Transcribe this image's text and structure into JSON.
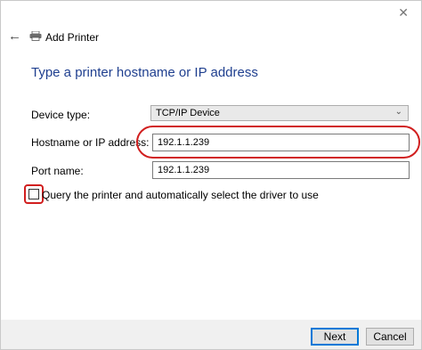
{
  "window": {
    "close_glyph": "✕"
  },
  "header": {
    "back_glyph": "←",
    "title": "Add Printer",
    "back_icon": "back-arrow-icon",
    "printer_icon": "printer-icon"
  },
  "page": {
    "heading": "Type a printer hostname or IP address"
  },
  "form": {
    "device_type": {
      "label": "Device type:",
      "value": "TCP/IP Device"
    },
    "hostname": {
      "label": "Hostname or IP address:",
      "value": "192.1.1.239"
    },
    "port": {
      "label": "Port name:",
      "value": "192.1.1.239"
    },
    "query": {
      "label": "Query the printer and automatically select the driver to use",
      "checked": false
    }
  },
  "buttons": {
    "next": "Next",
    "cancel": "Cancel"
  },
  "colors": {
    "heading": "#1f3f8f",
    "highlight": "#d11f1f",
    "accent": "#0078d7"
  }
}
